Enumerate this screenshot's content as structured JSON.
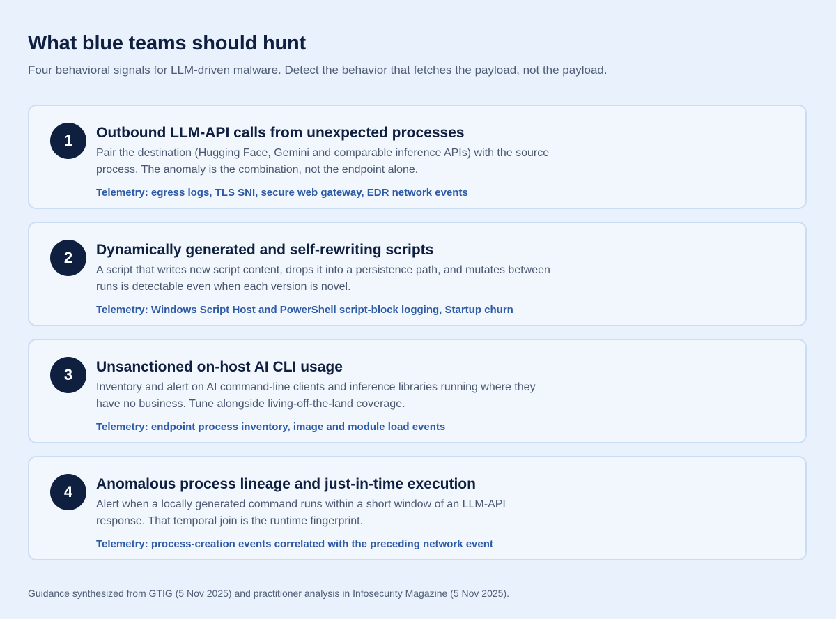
{
  "header": {
    "title": "What blue teams should hunt",
    "subtitle": "Four behavioral signals for LLM-driven malware. Detect the behavior that fetches the payload, not the payload."
  },
  "cards": [
    {
      "number": "1",
      "title": "Outbound LLM-API calls from unexpected processes",
      "description": "Pair the destination (Hugging Face, Gemini and comparable inference APIs) with the source process. The anomaly is the combination, not the endpoint alone.",
      "telemetry": "Telemetry: egress logs, TLS SNI, secure web gateway, EDR network events"
    },
    {
      "number": "2",
      "title": "Dynamically generated and self-rewriting scripts",
      "description": "A script that writes new script content, drops it into a persistence path, and mutates between runs is detectable even when each version is novel.",
      "telemetry": "Telemetry: Windows Script Host and PowerShell script-block logging, Startup churn"
    },
    {
      "number": "3",
      "title": "Unsanctioned on-host AI CLI usage",
      "description": "Inventory and alert on AI command-line clients and inference libraries running where they have no business. Tune alongside living-off-the-land coverage.",
      "telemetry": "Telemetry: endpoint process inventory, image and module load events"
    },
    {
      "number": "4",
      "title": "Anomalous process lineage and just-in-time execution",
      "description": "Alert when a locally generated command runs within a short window of an LLM-API response. That temporal join is the runtime fingerprint.",
      "telemetry": "Telemetry: process-creation events correlated with the preceding network event"
    }
  ],
  "footer": {
    "note": "Guidance synthesized from GTIG (5 Nov 2025) and practitioner analysis in Infosecurity Magazine (5 Nov 2025)."
  },
  "colors": {
    "background": "#e9f1fd",
    "card_background": "#f2f7fe",
    "card_border": "#cbdcf5",
    "badge": "#0e1f3f",
    "heading": "#0e1f3f",
    "body_text": "#4a586f",
    "telemetry_accent": "#2d5aa6"
  }
}
